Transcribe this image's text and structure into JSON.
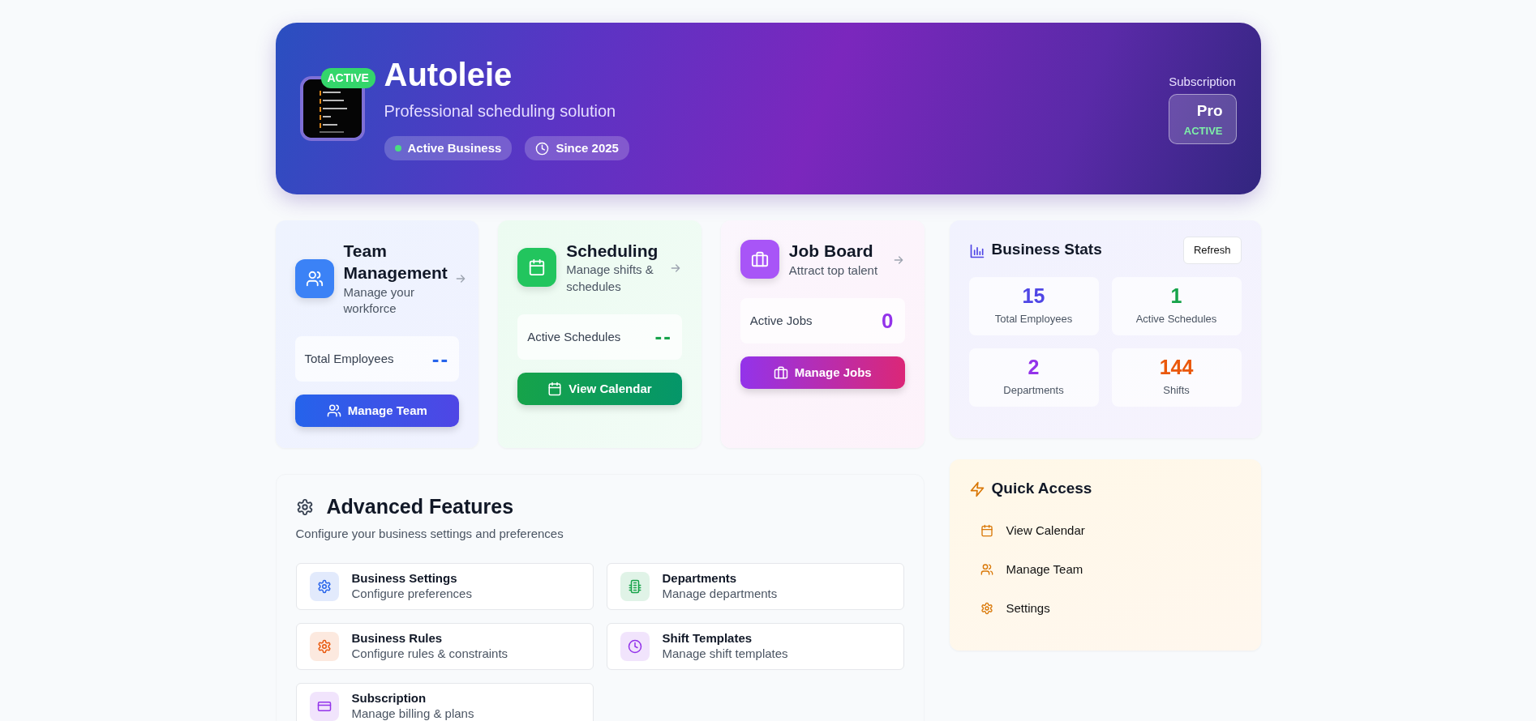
{
  "header": {
    "logo_badge": "ACTIVE",
    "name": "Autoleie",
    "tagline": "Professional scheduling solution",
    "tags": [
      {
        "kind": "status",
        "label": "Active Business",
        "color": "#4ade80"
      },
      {
        "kind": "clock",
        "label": "Since 2025"
      }
    ],
    "subscription": {
      "label": "Subscription",
      "plan": "Pro",
      "status": "ACTIVE"
    }
  },
  "feature_cards": [
    {
      "kind": "team",
      "title": "Team Management",
      "subtitle": "Manage your workforce",
      "stat_label": "Total Employees",
      "stat_value": "--",
      "button": "Manage Team"
    },
    {
      "kind": "scheduling",
      "title": "Scheduling",
      "subtitle": "Manage shifts & schedules",
      "stat_label": "Active Schedules",
      "stat_value": "--",
      "button": "View Calendar"
    },
    {
      "kind": "jobs",
      "title": "Job Board",
      "subtitle": "Attract top talent",
      "stat_label": "Active Jobs",
      "stat_value": "0",
      "button": "Manage Jobs"
    }
  ],
  "advanced": {
    "title": "Advanced Features",
    "subtitle": "Configure your business settings and preferences",
    "items": [
      {
        "kind": "gear",
        "title": "Business Settings",
        "subtitle": "Configure preferences",
        "color": "#2563eb"
      },
      {
        "kind": "building",
        "title": "Departments",
        "subtitle": "Manage departments",
        "color": "#16a34a"
      },
      {
        "kind": "gear",
        "title": "Business Rules",
        "subtitle": "Configure rules & constraints",
        "color": "#ea580c"
      },
      {
        "kind": "clock",
        "title": "Shift Templates",
        "subtitle": "Manage shift templates",
        "color": "#9333ea"
      },
      {
        "kind": "card",
        "title": "Subscription",
        "subtitle": "Manage billing & plans",
        "color": "#9333ea"
      }
    ]
  },
  "stats": {
    "title": "Business Stats",
    "refresh_button": "Refresh",
    "items": [
      {
        "value": "15",
        "label": "Total Employees",
        "color": "#4f46e5"
      },
      {
        "value": "1",
        "label": "Active Schedules",
        "color": "#16a34a"
      },
      {
        "value": "2",
        "label": "Departments",
        "color": "#9333ea"
      },
      {
        "value": "144",
        "label": "Shifts",
        "color": "#ea580c"
      }
    ]
  },
  "quick_access": {
    "title": "Quick Access",
    "items": [
      {
        "kind": "calendar",
        "label": "View Calendar"
      },
      {
        "kind": "users",
        "label": "Manage Team"
      },
      {
        "kind": "gear",
        "label": "Settings"
      }
    ]
  }
}
